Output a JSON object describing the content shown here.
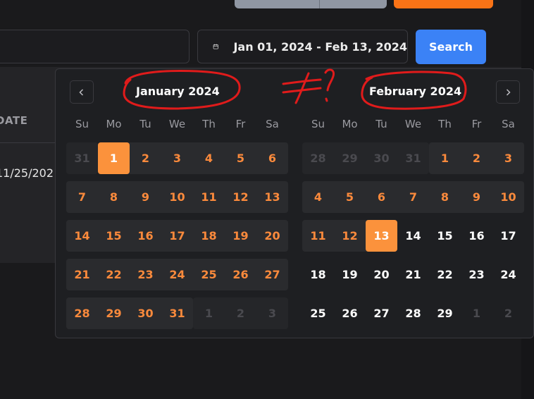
{
  "top": {
    "gray_button": "",
    "orange_button": ""
  },
  "search": {
    "value": "",
    "placeholder": ""
  },
  "date_range": {
    "text": "Jan 01, 2024 - Feb 13, 2024"
  },
  "search_button": {
    "label": "Search"
  },
  "table": {
    "date_header": "DATE",
    "row_date": "11/25/202"
  },
  "weekdays": [
    "Su",
    "Mo",
    "Tu",
    "We",
    "Th",
    "Fr",
    "Sa"
  ],
  "calendars": [
    {
      "title": "January 2024",
      "weeks": [
        [
          {
            "d": "31",
            "s": "outside"
          },
          {
            "d": "1",
            "s": "selected"
          },
          {
            "d": "2",
            "s": "inrange"
          },
          {
            "d": "3",
            "s": "inrange"
          },
          {
            "d": "4",
            "s": "inrange"
          },
          {
            "d": "5",
            "s": "inrange"
          },
          {
            "d": "6",
            "s": "inrange"
          }
        ],
        [
          {
            "d": "7",
            "s": "inrange"
          },
          {
            "d": "8",
            "s": "inrange"
          },
          {
            "d": "9",
            "s": "inrange"
          },
          {
            "d": "10",
            "s": "inrange"
          },
          {
            "d": "11",
            "s": "inrange"
          },
          {
            "d": "12",
            "s": "inrange"
          },
          {
            "d": "13",
            "s": "inrange"
          }
        ],
        [
          {
            "d": "14",
            "s": "inrange"
          },
          {
            "d": "15",
            "s": "inrange"
          },
          {
            "d": "16",
            "s": "inrange"
          },
          {
            "d": "17",
            "s": "inrange"
          },
          {
            "d": "18",
            "s": "inrange"
          },
          {
            "d": "19",
            "s": "inrange"
          },
          {
            "d": "20",
            "s": "inrange"
          }
        ],
        [
          {
            "d": "21",
            "s": "inrange"
          },
          {
            "d": "22",
            "s": "inrange"
          },
          {
            "d": "23",
            "s": "inrange"
          },
          {
            "d": "24",
            "s": "inrange"
          },
          {
            "d": "25",
            "s": "inrange"
          },
          {
            "d": "26",
            "s": "inrange"
          },
          {
            "d": "27",
            "s": "inrange"
          }
        ],
        [
          {
            "d": "28",
            "s": "inrange"
          },
          {
            "d": "29",
            "s": "inrange"
          },
          {
            "d": "30",
            "s": "inrange"
          },
          {
            "d": "31",
            "s": "inrange"
          },
          {
            "d": "1",
            "s": "outside"
          },
          {
            "d": "2",
            "s": "outside"
          },
          {
            "d": "3",
            "s": "outside"
          }
        ]
      ]
    },
    {
      "title": "February 2024",
      "weeks": [
        [
          {
            "d": "28",
            "s": "outside"
          },
          {
            "d": "29",
            "s": "outside"
          },
          {
            "d": "30",
            "s": "outside"
          },
          {
            "d": "31",
            "s": "outside"
          },
          {
            "d": "1",
            "s": "inrange"
          },
          {
            "d": "2",
            "s": "inrange"
          },
          {
            "d": "3",
            "s": "inrange"
          }
        ],
        [
          {
            "d": "4",
            "s": "inrange"
          },
          {
            "d": "5",
            "s": "inrange"
          },
          {
            "d": "6",
            "s": "inrange"
          },
          {
            "d": "7",
            "s": "inrange"
          },
          {
            "d": "8",
            "s": "inrange"
          },
          {
            "d": "9",
            "s": "inrange"
          },
          {
            "d": "10",
            "s": "inrange"
          }
        ],
        [
          {
            "d": "11",
            "s": "inrange"
          },
          {
            "d": "12",
            "s": "inrange"
          },
          {
            "d": "13",
            "s": "selected"
          },
          {
            "d": "14",
            "s": "normal"
          },
          {
            "d": "15",
            "s": "normal"
          },
          {
            "d": "16",
            "s": "normal"
          },
          {
            "d": "17",
            "s": "normal"
          }
        ],
        [
          {
            "d": "18",
            "s": "normal"
          },
          {
            "d": "19",
            "s": "normal"
          },
          {
            "d": "20",
            "s": "normal"
          },
          {
            "d": "21",
            "s": "normal"
          },
          {
            "d": "22",
            "s": "normal"
          },
          {
            "d": "23",
            "s": "normal"
          },
          {
            "d": "24",
            "s": "normal"
          }
        ],
        [
          {
            "d": "25",
            "s": "normal"
          },
          {
            "d": "26",
            "s": "normal"
          },
          {
            "d": "27",
            "s": "normal"
          },
          {
            "d": "28",
            "s": "normal"
          },
          {
            "d": "29",
            "s": "normal"
          },
          {
            "d": "1",
            "s": "outside"
          },
          {
            "d": "2",
            "s": "outside"
          }
        ]
      ]
    }
  ],
  "annotation": {
    "text": "≠?"
  },
  "colors": {
    "accent": "#fb923c",
    "range_text": "#fb8a3c",
    "search_blue": "#3b82f6",
    "annotation_red": "#e01b1b"
  }
}
